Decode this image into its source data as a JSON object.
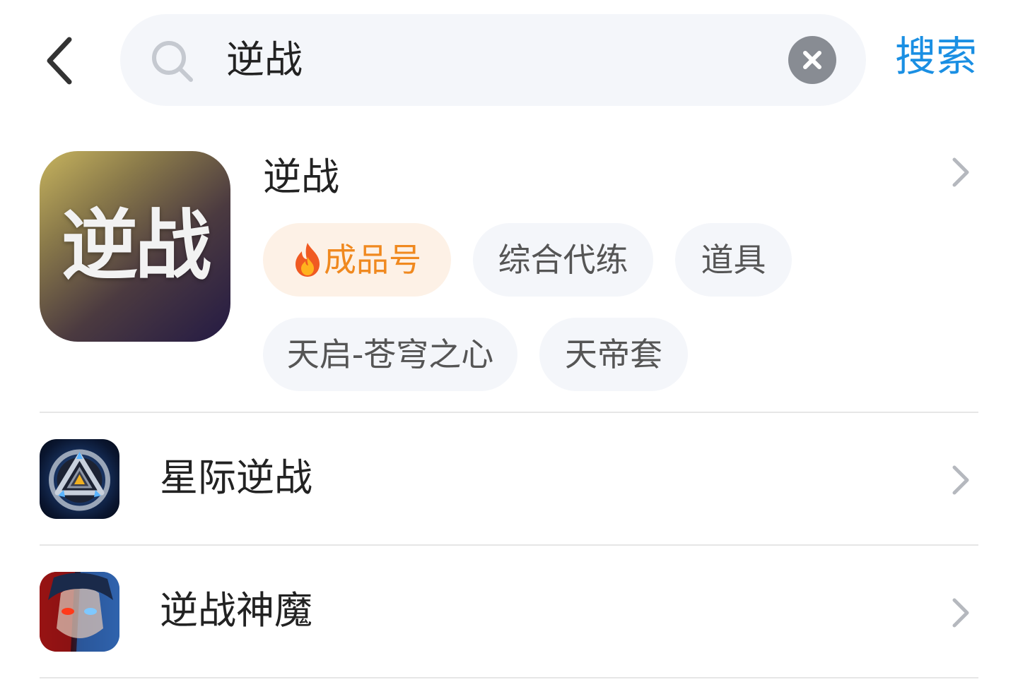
{
  "header": {
    "back_icon": "chevron-left-icon",
    "search": {
      "value": "逆战",
      "search_icon": "search-icon",
      "clear_icon": "close-icon"
    },
    "submit_label": "搜索",
    "accent_color": "#1a8fe3"
  },
  "featured": {
    "title": "逆战",
    "logo_text": "逆战",
    "tags": [
      {
        "label": "成品号",
        "hot": true,
        "icon": "fire-icon"
      },
      {
        "label": "综合代练",
        "hot": false
      },
      {
        "label": "道具",
        "hot": false
      },
      {
        "label": "天启-苍穹之心",
        "hot": false
      },
      {
        "label": "天帝套",
        "hot": false
      }
    ]
  },
  "results": [
    {
      "label": "星际逆战",
      "icon": "starship-emblem-icon"
    },
    {
      "label": "逆战神魔",
      "icon": "warrior-face-icon"
    }
  ]
}
